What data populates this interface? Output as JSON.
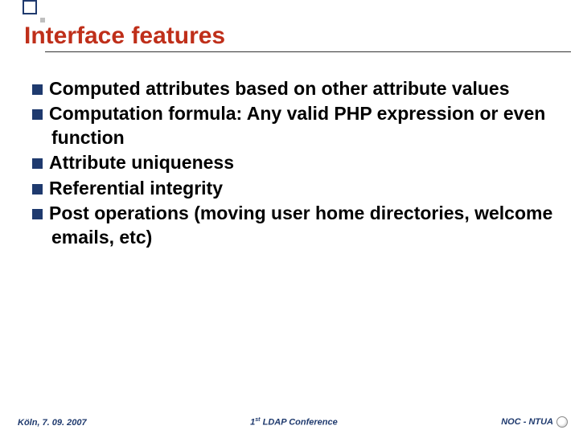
{
  "title": "Interface features",
  "bullets": [
    "Computed attributes based on other attribute values",
    "Computation formula: Any valid PHP expression or even function",
    "Attribute uniqueness",
    "Referential integrity",
    "Post operations (moving user home directories, welcome emails, etc)"
  ],
  "footer": {
    "left": "Köln, 7. 09. 2007",
    "center_pre": "1",
    "center_sup": "st",
    "center_post": "LDAP Conference",
    "right": "NOC - NTUA"
  }
}
